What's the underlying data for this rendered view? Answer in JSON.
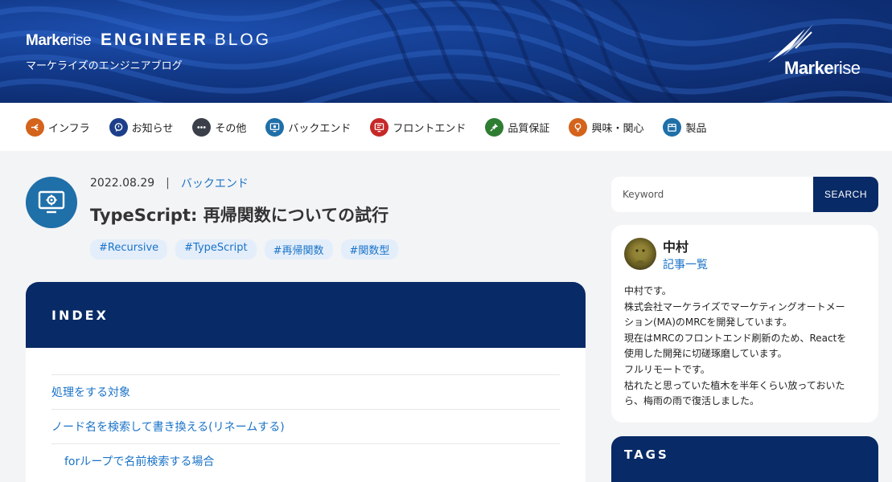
{
  "header": {
    "brand_bold": "Marke",
    "brand_thin": "rise",
    "blog_word1": "ENGINEER",
    "blog_word2": "BLOG",
    "subtitle": "マーケライズのエンジニアブログ",
    "corner_bold": "Marke",
    "corner_thin": "rise"
  },
  "nav": {
    "items": [
      {
        "label": "インフラ",
        "icon": "infra-icon",
        "color": "#d4631c"
      },
      {
        "label": "お知らせ",
        "icon": "chat-icon",
        "color": "#1d3f8a"
      },
      {
        "label": "その他",
        "icon": "dots-icon",
        "color": "#3b3f4a"
      },
      {
        "label": "バックエンド",
        "icon": "monitor-gear-icon",
        "color": "#1f6fa8"
      },
      {
        "label": "フロントエンド",
        "icon": "monitor-icon",
        "color": "#c62828"
      },
      {
        "label": "品質保証",
        "icon": "pin-icon",
        "color": "#2e7d32"
      },
      {
        "label": "興味・関心",
        "icon": "lightbulb-icon",
        "color": "#d4631c"
      },
      {
        "label": "製品",
        "icon": "box-icon",
        "color": "#1f6fa8"
      }
    ]
  },
  "article": {
    "date": "2022.08.29",
    "separator": "|",
    "category": "バックエンド",
    "title": "TypeScript: 再帰関数についての試行",
    "tags": [
      "#Recursive",
      "#TypeScript",
      "#再帰関数",
      "#関数型"
    ]
  },
  "index": {
    "title": "INDEX",
    "items": [
      {
        "label": "処理をする対象",
        "level": 1
      },
      {
        "label": "ノード名を検索して書き換える(リネームする)",
        "level": 1
      },
      {
        "label": "forループで名前検索する場合",
        "level": 2
      }
    ]
  },
  "sidebar": {
    "search_placeholder": "Keyword",
    "search_button": "SEARCH",
    "author": {
      "name": "中村",
      "link": "記事一覧",
      "bio": [
        "中村です。",
        "株式会社マーケライズでマーケティングオートメー",
        "ション(MA)のMRCを開発しています。",
        "現在はMRCのフロントエンド刷新のため、Reactを",
        "使用した開発に切磋琢磨しています。",
        "フルリモートです。",
        "枯れたと思っていた植木を半年くらい放っておいた",
        "ら、梅雨の雨で復活しました。"
      ]
    },
    "tags_title": "TAGS"
  },
  "colors": {
    "navy": "#082a66",
    "link": "#1a73c7",
    "tag_bg": "#e4eefb",
    "page_bg": "#f3f4f6"
  }
}
